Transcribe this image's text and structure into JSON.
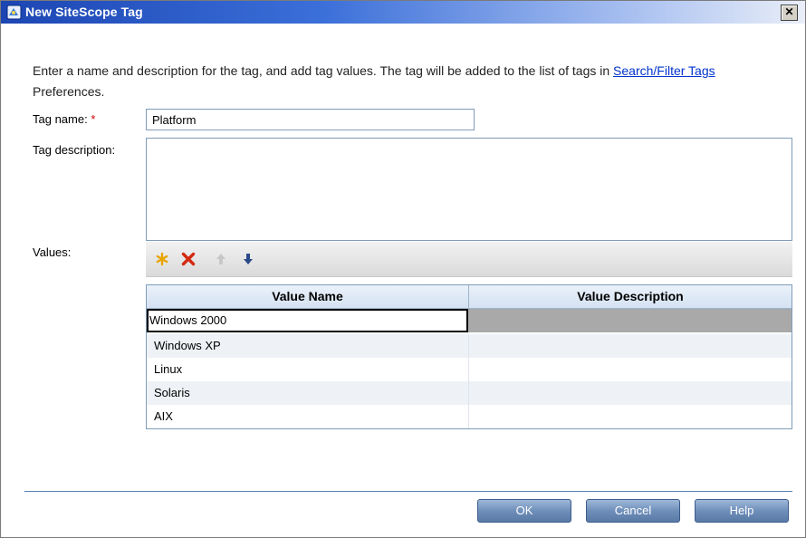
{
  "window": {
    "title": "New SiteScope Tag",
    "close_glyph": "✕",
    "app_icon": "sitescope-app-icon"
  },
  "intro": {
    "text_before_link": "Enter a name and description for the tag, and add tag values. The tag will be added to the list of tags in ",
    "link_text": "Search/Filter Tags",
    "text_after_link": " Preferences."
  },
  "form": {
    "tag_name_label": "Tag name:",
    "required_marker": "*",
    "tag_name_value": "Platform",
    "tag_description_label": "Tag description:",
    "tag_description_value": "",
    "values_label": "Values:"
  },
  "toolbar": {
    "icons": [
      "new-value-icon",
      "delete-value-icon",
      "move-up-icon",
      "move-down-icon"
    ]
  },
  "values_table": {
    "columns": [
      "Value Name",
      "Value Description"
    ],
    "rows": [
      {
        "name": "Windows 2000",
        "description": ""
      },
      {
        "name": "Windows XP",
        "description": ""
      },
      {
        "name": "Linux",
        "description": ""
      },
      {
        "name": "Solaris",
        "description": ""
      },
      {
        "name": "AIX",
        "description": ""
      }
    ]
  },
  "buttons": {
    "ok": "OK",
    "cancel": "Cancel",
    "help": "Help"
  },
  "colors": {
    "title_bar": "#1c46b3",
    "link": "#0033cc",
    "required": "#cc0000",
    "button": "#6f8fba"
  }
}
